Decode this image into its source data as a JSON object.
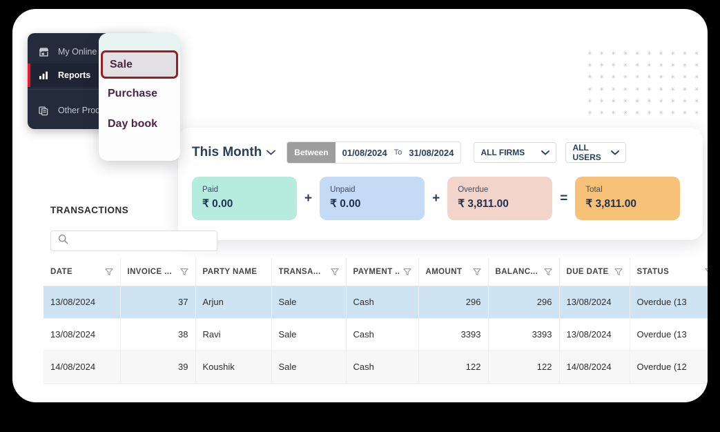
{
  "sidebar": {
    "items": [
      {
        "label": "My Online",
        "icon": "store-icon",
        "active": false
      },
      {
        "label": "Reports",
        "icon": "bar-chart-icon",
        "active": true
      },
      {
        "label": "Other Prod",
        "icon": "documents-icon",
        "active": false
      }
    ]
  },
  "report_menu": {
    "items": [
      {
        "label": "Sale",
        "highlighted": true
      },
      {
        "label": "Purchase",
        "highlighted": false
      },
      {
        "label": "Day book",
        "highlighted": false
      }
    ]
  },
  "filters": {
    "period_label": "This Month",
    "between_label": "Between",
    "date_from": "01/08/2024",
    "to_label": "To",
    "date_to": "31/08/2024",
    "firms_selected": "ALL FIRMS",
    "users_selected": "ALL USERS"
  },
  "summary": {
    "tiles": [
      {
        "label": "Paid",
        "value": "₹ 0.00",
        "color": "#b6ecdd"
      },
      {
        "label": "Unpaid",
        "value": "₹ 0.00",
        "color": "#c4daf5"
      },
      {
        "label": "Overdue",
        "value": "₹ 3,811.00",
        "color": "#f2d4cb"
      },
      {
        "label": "Total",
        "value": "₹ 3,811.00",
        "color": "#f7c278"
      }
    ],
    "operators": [
      "+",
      "+",
      "="
    ]
  },
  "transactions": {
    "heading": "TRANSACTIONS",
    "search_value": "",
    "search_placeholder": "",
    "columns": [
      {
        "label": "DATE",
        "filter": true,
        "align": "left"
      },
      {
        "label": "INVOICE ...",
        "filter": true,
        "align": "right"
      },
      {
        "label": "PARTY NAME",
        "filter": false,
        "align": "left"
      },
      {
        "label": "TRANSA...",
        "filter": true,
        "align": "left"
      },
      {
        "label": "PAYMENT ...",
        "filter": true,
        "align": "left"
      },
      {
        "label": "AMOUNT",
        "filter": true,
        "align": "right"
      },
      {
        "label": "BALANC...",
        "filter": true,
        "align": "right"
      },
      {
        "label": "DUE DATE",
        "filter": true,
        "align": "left"
      },
      {
        "label": "STATUS",
        "filter": true,
        "align": "left"
      }
    ],
    "rows": [
      {
        "selected": true,
        "date": "13/08/2024",
        "invoice": "37",
        "party": "Arjun",
        "transaction_type": "Sale",
        "payment_type": "Cash",
        "amount": "296",
        "balance": "296",
        "due_date": "13/08/2024",
        "status": "Overdue (13 "
      },
      {
        "selected": false,
        "date": "13/08/2024",
        "invoice": "38",
        "party": "Ravi",
        "transaction_type": "Sale",
        "payment_type": "Cash",
        "amount": "3393",
        "balance": "3393",
        "due_date": "13/08/2024",
        "status": "Overdue (13 "
      },
      {
        "selected": false,
        "date": "14/08/2024",
        "invoice": "39",
        "party": "Koushik",
        "transaction_type": "Sale",
        "payment_type": "Cash",
        "amount": "122",
        "balance": "122",
        "due_date": "14/08/2024",
        "status": "Overdue (12 "
      }
    ]
  },
  "theme": {
    "page_bg": "#000000",
    "card_bg": "#ffffff",
    "sidebar_bg": "#242c3c",
    "sidebar_active_bg": "#1d2433",
    "accent_red": "#e8192c",
    "menu_highlight_border": "#9b1c23",
    "menu_text": "#4a2545",
    "row_selected_bg": "#cfe4f2",
    "overdue_text": "#f4623a",
    "heading_blue": "#28405d"
  }
}
